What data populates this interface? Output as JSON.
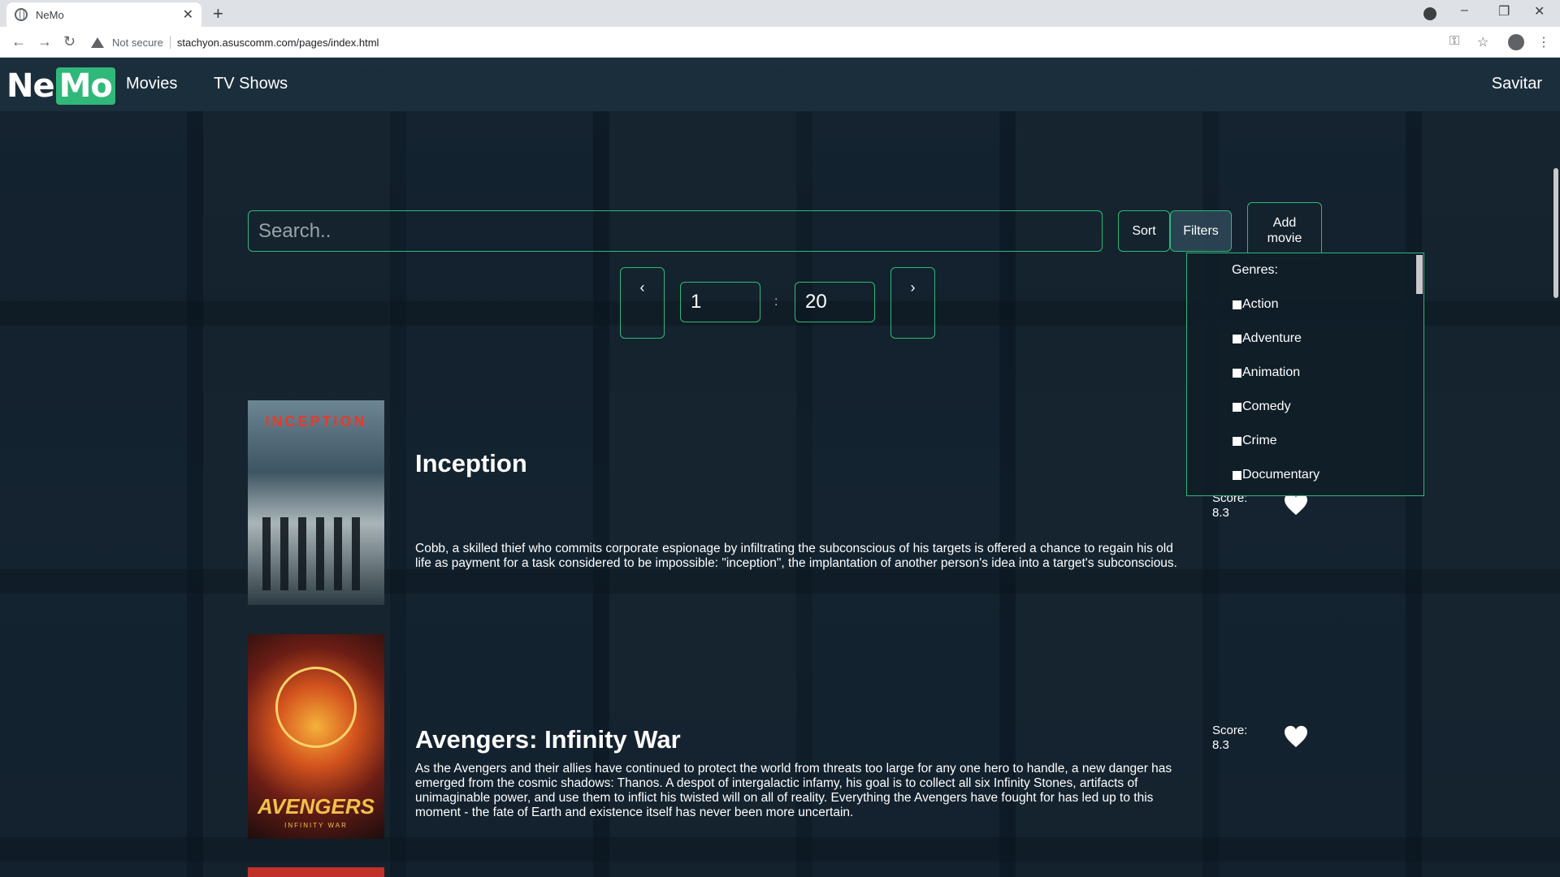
{
  "browser": {
    "tab_title": "NeMo",
    "new_tab": "+",
    "not_secure": "Not secure",
    "url": "stachyon.asuscomm.com/pages/index.html"
  },
  "nav": {
    "logo_ne": "Ne",
    "logo_mo": "Mo",
    "movies": "Movies",
    "tv_shows": "TV Shows",
    "user": "Savitar"
  },
  "search": {
    "placeholder": "Search.."
  },
  "buttons": {
    "sort": "Sort",
    "filters": "Filters",
    "add_line1": "Add",
    "add_line2": "movie"
  },
  "pagination": {
    "prev": "‹",
    "next": "›",
    "from": "1",
    "separator": ":",
    "to": "20"
  },
  "filters": {
    "title": "Genres:",
    "genres": [
      "Action",
      "Adventure",
      "Animation",
      "Comedy",
      "Crime",
      "Documentary"
    ]
  },
  "movies": [
    {
      "title": "Inception",
      "poster_text": "INCEPTION",
      "description": "Cobb, a skilled thief who commits corporate espionage by infiltrating the subconscious of his targets is offered a chance to regain his old life as payment for a task considered to be impossible: \"inception\", the implantation of another person's idea into a target's subconscious.",
      "score_label": "Score:",
      "score": "8.3"
    },
    {
      "title": "Avengers: Infinity War",
      "poster_text": "AVENGERS",
      "poster_sub": "INFINITY WAR",
      "description": "As the Avengers and their allies have continued to protect the world from threats too large for any one hero to handle, a new danger has emerged from the cosmic shadows: Thanos. A despot of intergalactic infamy, his goal is to collect all six Infinity Stones, artifacts of unimaginable power, and use them to inflict his twisted will on all of reality. Everything the Avengers have fought for has led up to this moment - the fate of Earth and existence itself has never been more uncertain.",
      "score_label": "Score:",
      "score": "8.3"
    }
  ],
  "colors": {
    "accent": "#2fb87a",
    "navbar": "#1c303e",
    "background": "#0f1a24"
  }
}
